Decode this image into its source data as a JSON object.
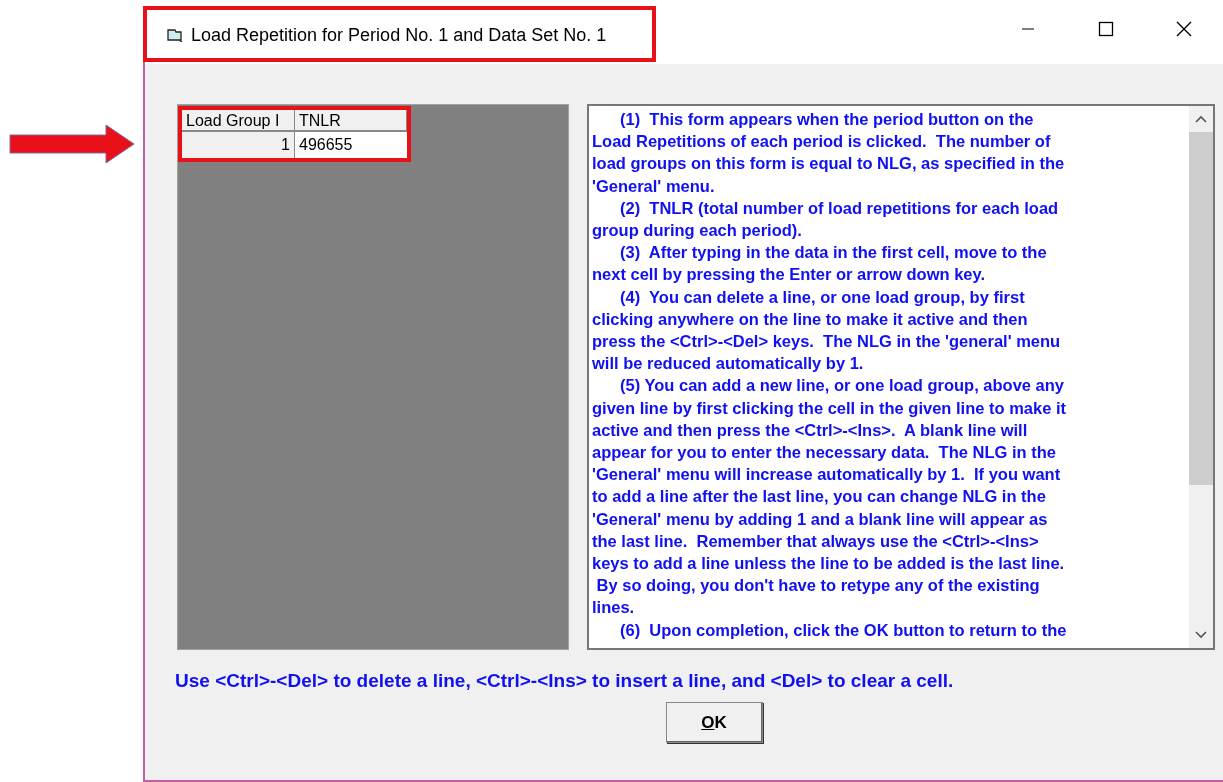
{
  "window": {
    "title": "Load Repetition for Period No. 1 and Data Set No. 1"
  },
  "grid": {
    "columns": [
      "Load Group I",
      "TNLR"
    ],
    "rows": [
      {
        "cells": [
          "1",
          "496655"
        ]
      }
    ]
  },
  "help_lines": [
    {
      "text": "(1)  This form appears when the period button on the",
      "indent": true
    },
    {
      "text": "Load Repetitions of each period is clicked.  The number of",
      "indent": false
    },
    {
      "text": "load groups on this form is equal to NLG, as specified in the",
      "indent": false
    },
    {
      "text": "'General' menu.",
      "indent": false
    },
    {
      "text": "(2)  TNLR (total number of load repetitions for each load",
      "indent": true
    },
    {
      "text": "group during each period).",
      "indent": false
    },
    {
      "text": "(3)  After typing in the data in the first cell, move to the",
      "indent": true
    },
    {
      "text": "next cell by pressing the Enter or arrow down key.",
      "indent": false
    },
    {
      "text": "(4)  You can delete a line, or one load group, by first",
      "indent": true
    },
    {
      "text": "clicking anywhere on the line to make it active and then",
      "indent": false
    },
    {
      "text": "press the <Ctrl>-<Del> keys.  The NLG in the 'general' menu",
      "indent": false
    },
    {
      "text": "will be reduced automatically by 1.",
      "indent": false
    },
    {
      "text": "(5) You can add a new line, or one load group, above any",
      "indent": true
    },
    {
      "text": "given line by first clicking the cell in the given line to make it",
      "indent": false
    },
    {
      "text": "active and then press the <Ctrl>-<Ins>.  A blank line will",
      "indent": false
    },
    {
      "text": "appear for you to enter the necessary data.  The NLG in the",
      "indent": false
    },
    {
      "text": "'General' menu will increase automatically by 1.  If you want",
      "indent": false
    },
    {
      "text": "to add a line after the last line, you can change NLG in the",
      "indent": false
    },
    {
      "text": "'General' menu by adding 1 and a blank line will appear as",
      "indent": false
    },
    {
      "text": "the last line.  Remember that always use the <Ctrl>-<Ins>",
      "indent": false
    },
    {
      "text": "keys to add a line unless the line to be added is the last line.",
      "indent": false
    },
    {
      "text": " By so doing, you don't have to retype any of the existing",
      "indent": false
    },
    {
      "text": "lines.",
      "indent": false
    },
    {
      "text": "(6)  Upon completion, click the OK button to return to the",
      "indent": true
    }
  ],
  "hint": "Use <Ctrl>-<Del> to delete a line, <Ctrl>-<Ins> to insert a line, and <Del> to clear a cell.",
  "buttons": [
    "OK"
  ]
}
